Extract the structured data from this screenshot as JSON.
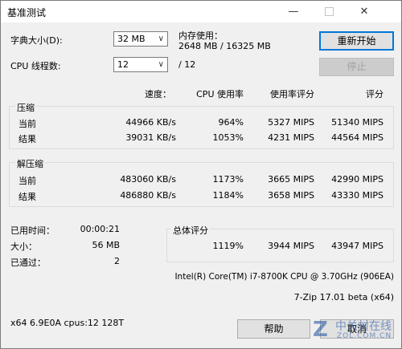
{
  "window": {
    "title": "基准测试"
  },
  "controls": {
    "dict_label": "字典大小(D):",
    "dict_value": "32 MB",
    "threads_label": "CPU 线程数:",
    "threads_value": "12",
    "threads_total": "/ 12"
  },
  "memory": {
    "label": "内存使用：",
    "value": "2648 MB / 16325 MB"
  },
  "buttons": {
    "restart": "重新开始",
    "stop": "停止",
    "help": "帮助",
    "cancel": "取消"
  },
  "columns": {
    "speed": "速度：",
    "cpu_usage": "CPU 使用率",
    "rating_usage": "使用率评分",
    "rating": "评分"
  },
  "compress": {
    "title": "压缩",
    "current": {
      "label": "当前",
      "speed": "44966 KB/s",
      "cpu": "964%",
      "rating_usage": "5327 MIPS",
      "rating": "51340 MIPS"
    },
    "result": {
      "label": "结果",
      "speed": "39031 KB/s",
      "cpu": "1053%",
      "rating_usage": "4231 MIPS",
      "rating": "44564 MIPS"
    }
  },
  "decompress": {
    "title": "解压缩",
    "current": {
      "label": "当前",
      "speed": "483060 KB/s",
      "cpu": "1173%",
      "rating_usage": "3665 MIPS",
      "rating": "42990 MIPS"
    },
    "result": {
      "label": "结果",
      "speed": "486880 KB/s",
      "cpu": "1184%",
      "rating_usage": "3658 MIPS",
      "rating": "43330 MIPS"
    }
  },
  "stats": {
    "elapsed_label": "已用时间：",
    "elapsed_value": "00:00:21",
    "size_label": "大小：",
    "size_value": "56 MB",
    "passes_label": "已通过：",
    "passes_value": "2"
  },
  "total": {
    "title": "总体评分",
    "cpu": "1119%",
    "rating_usage": "3944 MIPS",
    "rating": "43947 MIPS"
  },
  "cpu_info": "Intel(R) Core(TM) i7-8700K CPU @ 3.70GHz (906EA)",
  "version": "7-Zip 17.01 beta (x64)",
  "system": "x64 6.9E0A cpus:12 128T",
  "watermark": {
    "cn": "中关村在线",
    "en": "ZOL.COM.CN"
  }
}
